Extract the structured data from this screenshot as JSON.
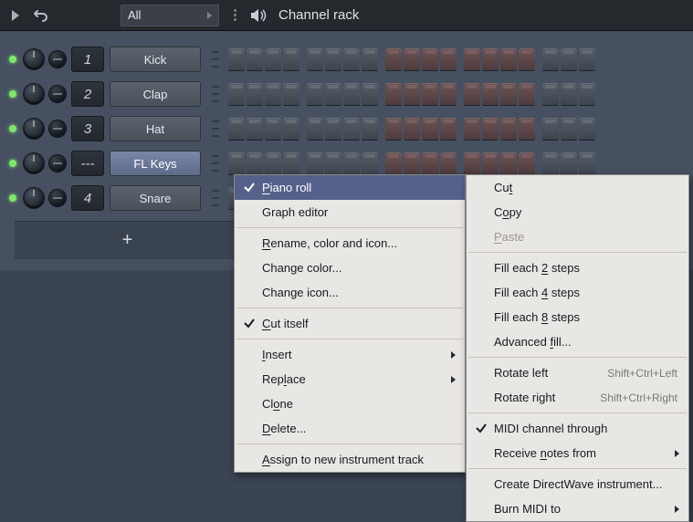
{
  "topbar": {
    "filter_label": "All",
    "title": "Channel rack"
  },
  "channels": [
    {
      "num": "1",
      "name": "Kick",
      "selected": false
    },
    {
      "num": "2",
      "name": "Clap",
      "selected": false
    },
    {
      "num": "3",
      "name": "Hat",
      "selected": false
    },
    {
      "num": "---",
      "name": "FL Keys",
      "selected": true
    },
    {
      "num": "4",
      "name": "Snare",
      "selected": false
    }
  ],
  "add_label": "+",
  "step_groups": 4,
  "steps_per_group": 4,
  "red_group_start": 2,
  "menu1": {
    "items": [
      {
        "label_pre": "",
        "u": "P",
        "label_post": "iano roll",
        "highlight": true,
        "checked": true
      },
      {
        "label_pre": "Graph editor",
        "u": "",
        "label_post": ""
      },
      {
        "sep": true
      },
      {
        "label_pre": "",
        "u": "R",
        "label_post": "ename, color and icon..."
      },
      {
        "label_pre": "Change color...",
        "u": "",
        "label_post": ""
      },
      {
        "label_pre": "Change icon...",
        "u": "",
        "label_post": ""
      },
      {
        "sep": true
      },
      {
        "label_pre": "",
        "u": "C",
        "label_post": "ut itself",
        "checked": true
      },
      {
        "sep": true
      },
      {
        "label_pre": "",
        "u": "I",
        "label_post": "nsert",
        "submenu": true
      },
      {
        "label_pre": "Rep",
        "u": "l",
        "label_post": "ace",
        "submenu": true
      },
      {
        "label_pre": "Cl",
        "u": "o",
        "label_post": "ne"
      },
      {
        "label_pre": "",
        "u": "D",
        "label_post": "elete..."
      },
      {
        "sep": true
      },
      {
        "label_pre": "",
        "u": "A",
        "label_post": "ssign to new instrument track"
      }
    ]
  },
  "menu2": {
    "items": [
      {
        "label_pre": "Cu",
        "u": "t",
        "label_post": ""
      },
      {
        "label_pre": "C",
        "u": "o",
        "label_post": "py"
      },
      {
        "label_pre": "",
        "u": "P",
        "label_post": "aste",
        "disabled": true
      },
      {
        "sep": true
      },
      {
        "label_pre": "Fill each ",
        "u": "2",
        "label_post": " steps"
      },
      {
        "label_pre": "Fill each ",
        "u": "4",
        "label_post": " steps"
      },
      {
        "label_pre": "Fill each ",
        "u": "8",
        "label_post": " steps"
      },
      {
        "label_pre": "Advanced ",
        "u": "f",
        "label_post": "ill..."
      },
      {
        "sep": true
      },
      {
        "label_pre": "Rotate left",
        "u": "",
        "label_post": "",
        "shortcut": "Shift+Ctrl+Left"
      },
      {
        "label_pre": "Rotate right",
        "u": "",
        "label_post": "",
        "shortcut": "Shift+Ctrl+Right"
      },
      {
        "sep": true
      },
      {
        "label_pre": "MIDI channel through",
        "u": "",
        "label_post": "",
        "checked": true
      },
      {
        "label_pre": "Receive ",
        "u": "n",
        "label_post": "otes from",
        "submenu": true
      },
      {
        "sep": true
      },
      {
        "label_pre": "Create DirectWave instrument...",
        "u": "",
        "label_post": ""
      },
      {
        "label_pre": "Burn MIDI to",
        "u": "",
        "label_post": "",
        "submenu": true
      }
    ]
  }
}
